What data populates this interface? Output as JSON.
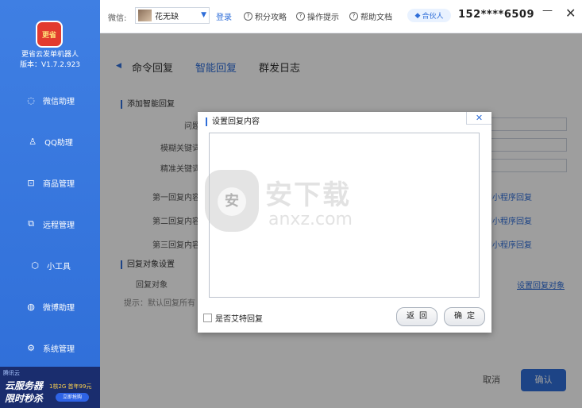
{
  "sidebar": {
    "logo_text": "更省",
    "app_name": "更省云发单机器人",
    "version": "版本：V1.7.2.923",
    "items": [
      {
        "label": "微信助理",
        "icon": "wechat-bubble-icon"
      },
      {
        "label": "QQ助理",
        "icon": "qq-penguin-icon"
      },
      {
        "label": "商品管理",
        "icon": "cart-icon"
      },
      {
        "label": "远程管理",
        "icon": "remote-icon"
      },
      {
        "label": "小工具",
        "icon": "tool-hex-icon"
      },
      {
        "label": "微博助理",
        "icon": "weibo-icon"
      },
      {
        "label": "系统管理",
        "icon": "gear-icon"
      }
    ],
    "ad": {
      "brand": "腾讯云",
      "line1": "云服务器",
      "line2": "限时秒杀",
      "price": "1核2G 首年99元",
      "button": "立即抢购"
    }
  },
  "topbar": {
    "wechat_label": "微信:",
    "account_name": "花无缺",
    "login": "登录",
    "links": [
      "积分攻略",
      "操作提示",
      "帮助文档"
    ],
    "partner": "合伙人",
    "phone": "152****6509",
    "minimize": "—",
    "close": "✕"
  },
  "main": {
    "tabs": [
      "命令回复",
      "智能回复",
      "群发日志"
    ],
    "active_tab": "智能回复",
    "section1": "添加智能回复",
    "fields": [
      "问题",
      "模糊关键词",
      "精准关键词",
      "第一回复内容",
      "第二回复内容",
      "第三回复内容"
    ],
    "add_mini": "添加小程序回复",
    "section2": "回复对象设置",
    "reply_obj_label": "回复对象",
    "set_obj_link": "设置回复对象",
    "hint": "提示：默认回复所有",
    "cancel": "取消",
    "confirm": "确认"
  },
  "modal": {
    "title": "设置回复内容",
    "close": "✕",
    "content": "",
    "checkbox_label": "是否艾特回复",
    "return_button": "返回",
    "ok_button": "确定"
  },
  "watermark": {
    "cn": "安下载",
    "en": "anxz.com",
    "badge": "安"
  },
  "colors": {
    "primary": "#2f6ed8",
    "sidebar": "#3f7fe3",
    "overlay": "rgba(0,0,0,0.38)"
  }
}
